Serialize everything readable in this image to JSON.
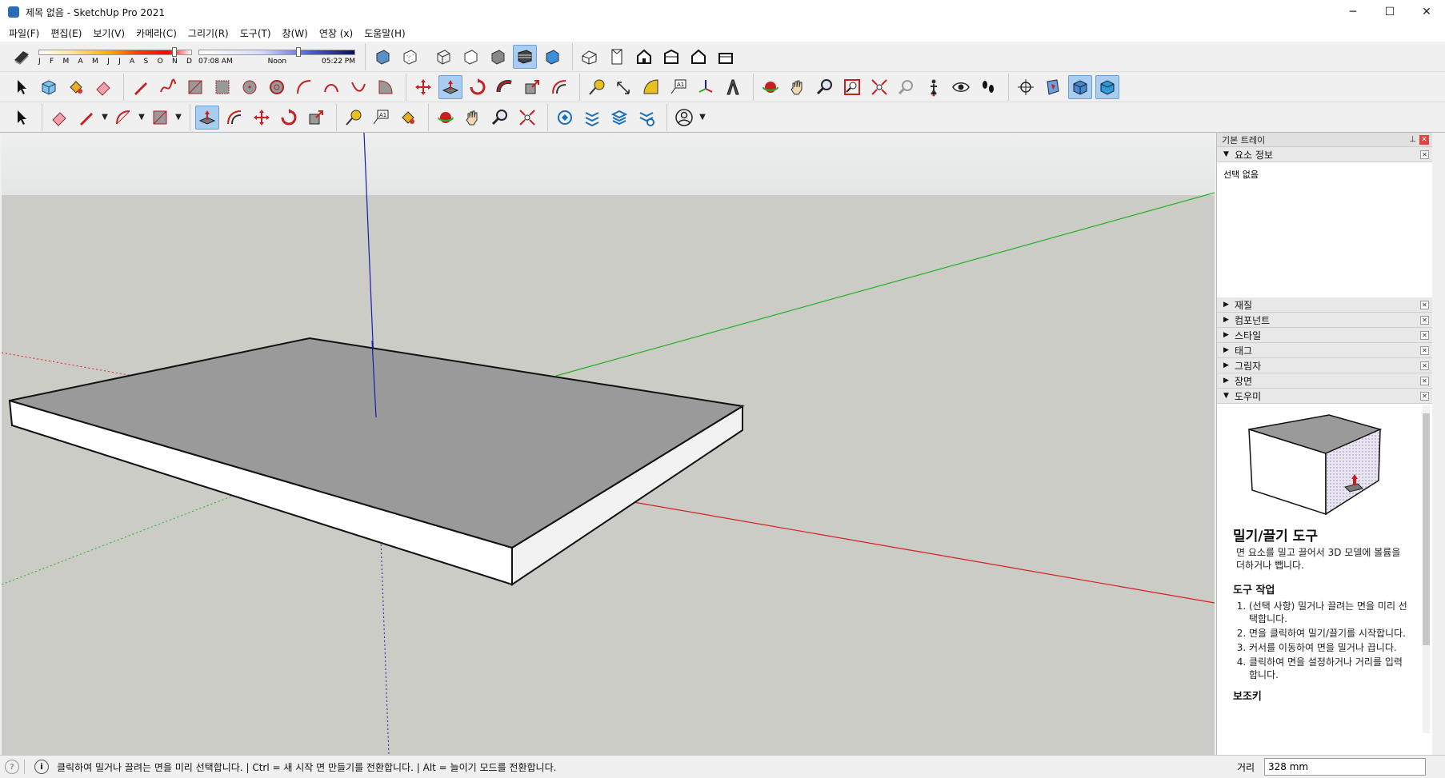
{
  "window": {
    "title": "제목 없음 - SketchUp Pro 2021",
    "minimize": "─",
    "maximize": "☐",
    "close": "✕"
  },
  "menu": [
    "파일(F)",
    "편집(E)",
    "보기(V)",
    "카메라(C)",
    "그리기(R)",
    "도구(T)",
    "창(W)",
    "연장 (x)",
    "도움말(H)"
  ],
  "shadow": {
    "months": [
      "J",
      "F",
      "M",
      "A",
      "M",
      "J",
      "J",
      "A",
      "S",
      "O",
      "N",
      "D"
    ],
    "month_position": 0.9,
    "time_start": "07:08 AM",
    "time_mid": "Noon",
    "time_end": "05:22 PM",
    "time_position": 0.64
  },
  "tray": {
    "title": "기본 트레이",
    "entity_info": {
      "label": "요소 정보",
      "body": "선택 없음"
    },
    "panels": [
      "재질",
      "컴포넌트",
      "스타일",
      "태그",
      "그림자",
      "장면"
    ],
    "instructor": {
      "label": "도우미",
      "tool_title": "밀기/끌기 도구",
      "tool_desc": "면 요소를 밀고 끌어서 3D 모델에 볼륨을 더하거나 뺍니다.",
      "ops_title": "도구 작업",
      "steps": [
        "(선택 사항) 밀거나 끌려는 면을 미리 선택합니다.",
        "면을 클릭하여 밀기/끌기를 시작합니다.",
        "커서를 이동하여 면을 밀거나 끕니다.",
        "클릭하여 면을 설정하거나 거리를 입력합니다."
      ],
      "modifier_title": "보조키"
    }
  },
  "status": {
    "message": "클릭하여 밀거나 끌려는 면을 미리 선택합니다. | Ctrl = 새 시작 면 만들기를 전환합니다. | Alt = 늘이기 모드를 전환합니다.",
    "measure_label": "거리",
    "measure_value": "328 mm"
  },
  "colors": {
    "red_axis": "#d42020",
    "green_axis": "#23b023",
    "blue_axis": "#1a1ab0",
    "face_top": "#9a9a9a",
    "face_side": "#ffffff",
    "ground": "#cbccc6",
    "sky": "#eceeee"
  }
}
